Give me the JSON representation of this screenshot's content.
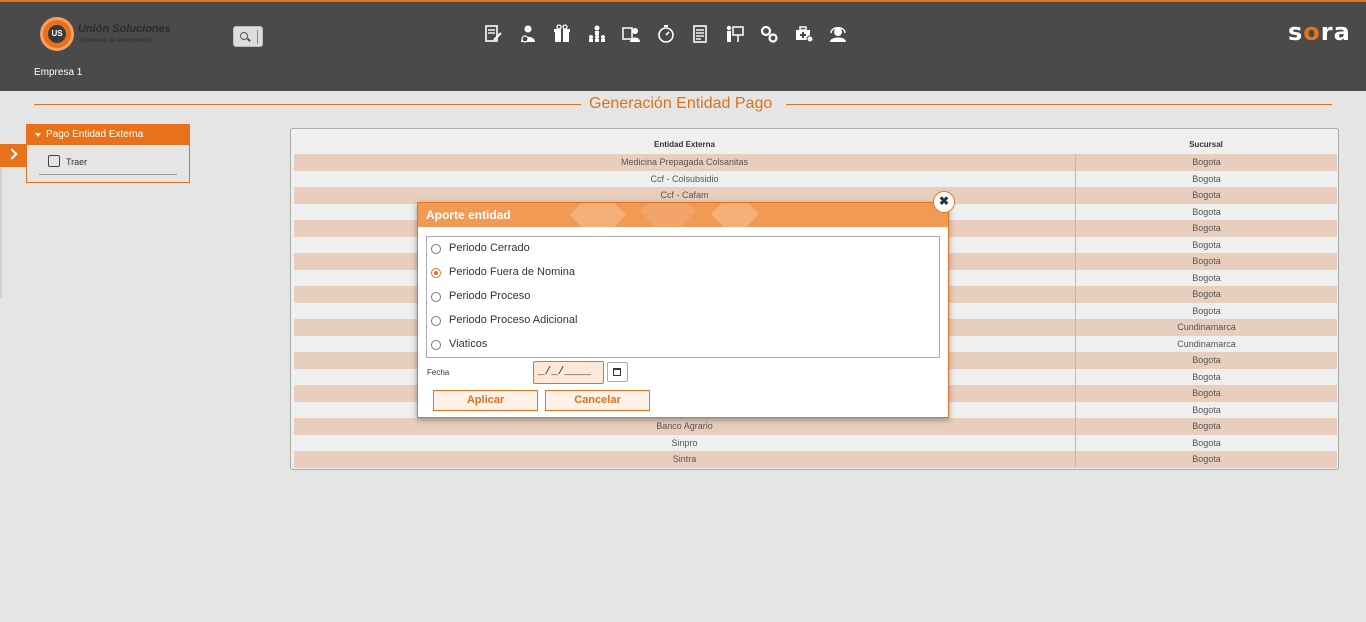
{
  "header": {
    "logo_name": "Unión Soluciones",
    "logo_sub": "Sistemas de Información",
    "logo_mark": "US",
    "company": "Empresa 1",
    "brand_left": "s",
    "brand_o": "o",
    "brand_right": "ra",
    "toolbar_icons": [
      "document-edit-icon",
      "user-money-icon",
      "gift-icon",
      "org-chart-icon",
      "user-badge-icon",
      "stopwatch-icon",
      "report-icon",
      "presentation-icon",
      "gears-icon",
      "medical-kit-icon",
      "support-agent-icon"
    ]
  },
  "page": {
    "title": "Generación Entidad Pago"
  },
  "sidebar": {
    "panel_title": "Pago Entidad Externa",
    "item_label": "Traer"
  },
  "table": {
    "headers": [
      "Entidad Externa",
      "Sucursal"
    ],
    "rows": [
      [
        "Medicina Prepagada Colsanitas",
        "Bogota"
      ],
      [
        "Ccf - Colsubsidio",
        "Bogota"
      ],
      [
        "Ccf - Cafam",
        "Bogota"
      ],
      [
        "",
        "Bogota"
      ],
      [
        "",
        "Bogota"
      ],
      [
        "",
        "Bogota"
      ],
      [
        "",
        "Bogota"
      ],
      [
        "",
        "Bogota"
      ],
      [
        "",
        "Bogota"
      ],
      [
        "",
        "Bogota"
      ],
      [
        "",
        "Cundinamarca"
      ],
      [
        "",
        "Cundinamarca"
      ],
      [
        "",
        "Bogota"
      ],
      [
        "",
        "Bogota"
      ],
      [
        "",
        "Bogota"
      ],
      [
        "",
        "Bogota"
      ],
      [
        "Banco Agrario",
        "Bogota"
      ],
      [
        "Sinpro",
        "Bogota"
      ],
      [
        "Sintra",
        "Bogota"
      ]
    ]
  },
  "modal": {
    "title": "Aporte entidad",
    "options": [
      {
        "label": "Periodo Cerrado",
        "selected": false
      },
      {
        "label": "Periodo Fuera de Nomina",
        "selected": true
      },
      {
        "label": "Periodo Proceso",
        "selected": false
      },
      {
        "label": "Periodo Proceso Adicional",
        "selected": false
      },
      {
        "label": "Viaticos",
        "selected": false
      }
    ],
    "fecha_label": "Fecha",
    "fecha_value": "_/_/____",
    "apply_label": "Aplicar",
    "cancel_label": "Cancelar",
    "close_glyph": "✖"
  },
  "colors": {
    "accent": "#e8721c",
    "header_bg": "#4a4a4a",
    "row_odd": "#e8cfbd"
  }
}
